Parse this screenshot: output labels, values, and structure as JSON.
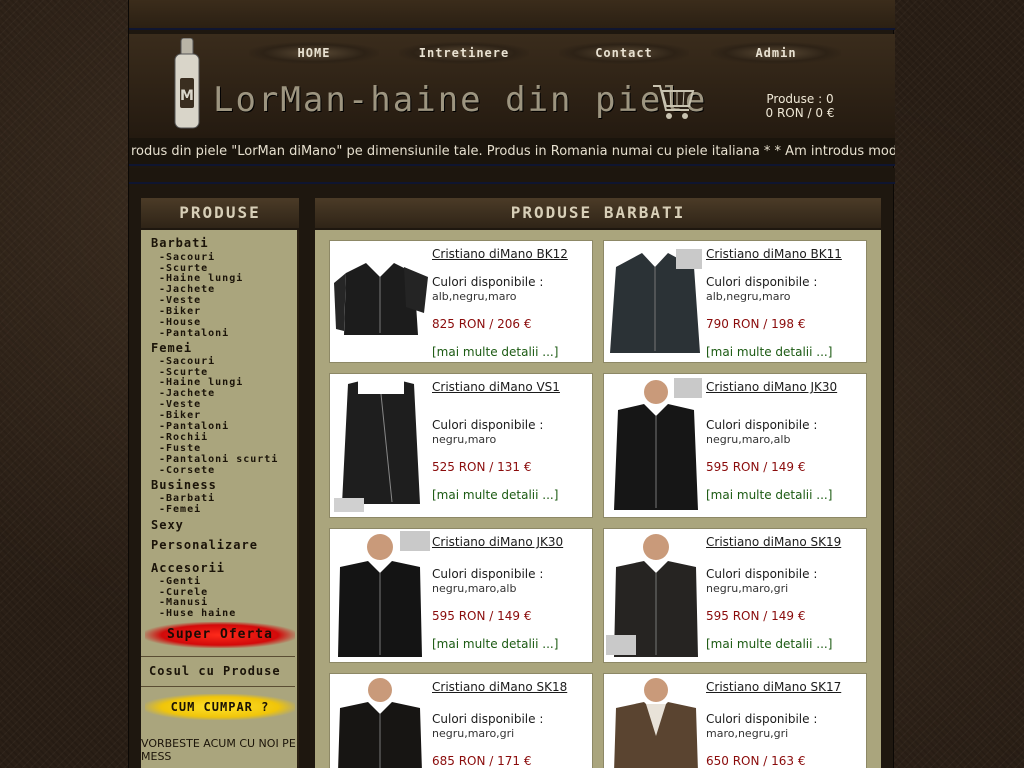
{
  "nav": {
    "items": [
      "HOME",
      "Intretinere",
      "Contact",
      "Admin"
    ]
  },
  "logo": {
    "text": "LorMan-haine din piele"
  },
  "cart": {
    "products": "Produse : 0",
    "total": "0 RON / 0 €"
  },
  "ticker": {
    "text": "rodus din piele \"LorMan diMano\" pe dimensiunile tale. Produs in Romania numai cu piele italiana * * Am introdus modele no"
  },
  "sidebar": {
    "heading": "PRODUSE",
    "barbati": {
      "label": "Barbati",
      "items": [
        "-Sacouri",
        "-Scurte",
        "-Haine lungi",
        "-Jachete",
        "-Veste",
        "-Biker",
        "-House",
        "-Pantaloni"
      ]
    },
    "femei": {
      "label": "Femei",
      "items": [
        "-Sacouri",
        "-Scurte",
        "-Haine lungi",
        "-Jachete",
        "-Veste",
        "-Biker",
        "-Pantaloni",
        "-Rochii",
        "-Fuste",
        "-Pantaloni scurti",
        "-Corsete"
      ]
    },
    "business": {
      "label": "Business",
      "items": [
        "-Barbati",
        "-Femei"
      ]
    },
    "sexy": "Sexy",
    "personalizare": "Personalizare",
    "accesorii": {
      "label": "Accesorii",
      "items": [
        "-Genti",
        "-Curele",
        "-Manusi",
        "-Huse haine"
      ]
    },
    "super_oferta": "Super Oferta",
    "cosul": "Cosul cu Produse",
    "cum_cumpar": "CUM CUMPAR ?",
    "vorbeste": "VORBESTE ACUM CU NOI PE MESS"
  },
  "main": {
    "heading": "PRODUSE BARBATI",
    "colors_label": "Culori disponibile :",
    "more_label": "[mai multe detalii ...]",
    "products": [
      {
        "title": "Cristiano diMano BK12",
        "colors": "alb,negru,maro",
        "price": "825 RON / 206 €"
      },
      {
        "title": "Cristiano diMano BK11",
        "colors": "alb,negru,maro",
        "price": "790 RON / 198 €"
      },
      {
        "title": "Cristiano diMano VS1",
        "colors": "negru,maro",
        "price": "525 RON / 131 €"
      },
      {
        "title": "Cristiano diMano JK30",
        "colors": "negru,maro,alb",
        "price": "595 RON / 149 €"
      },
      {
        "title": "Cristiano diMano JK30",
        "colors": "negru,maro,alb",
        "price": "595 RON / 149 €"
      },
      {
        "title": "Cristiano diMano SK19",
        "colors": "negru,maro,gri",
        "price": "595 RON / 149 €"
      },
      {
        "title": "Cristiano diMano SK18",
        "colors": "negru,maro,gri",
        "price": "685 RON / 171 €"
      },
      {
        "title": "Cristiano diMano SK17",
        "colors": "maro,negru,gri",
        "price": "650 RON / 163 €"
      }
    ]
  }
}
